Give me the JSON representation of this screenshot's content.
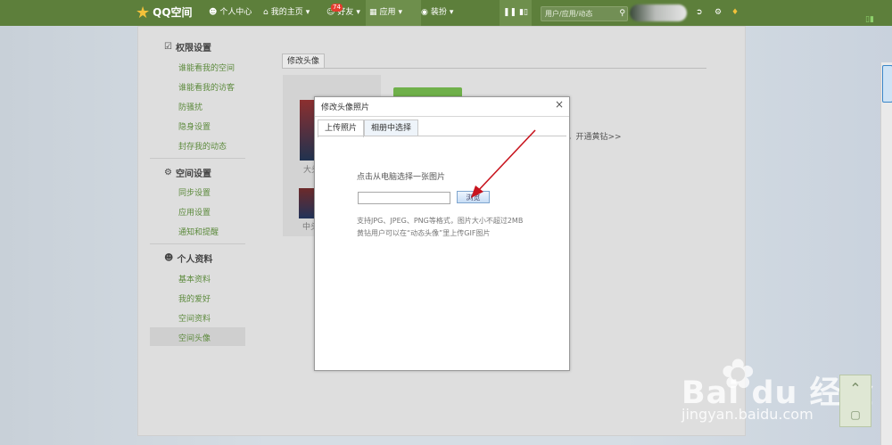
{
  "topbar": {
    "logo_text": "QQ空间",
    "nav": [
      {
        "label": "个人中心"
      },
      {
        "label": "我的主页",
        "has_dropdown": true
      },
      {
        "label": "好友",
        "badge": "74",
        "has_dropdown": true
      },
      {
        "label": "应用",
        "has_dropdown": true,
        "active": true
      },
      {
        "label": "装扮",
        "has_dropdown": true
      }
    ],
    "search_placeholder": "用户/应用/动态"
  },
  "sidebar": {
    "sections": [
      {
        "title": "权限设置",
        "icon": "lock-icon",
        "items": [
          "谁能看我的空间",
          "谁能看我的访客",
          "防骚扰",
          "隐身设置",
          "封存我的动态"
        ]
      },
      {
        "title": "空间设置",
        "icon": "settings-icon",
        "items": [
          "同步设置",
          "应用设置",
          "通知和提醒"
        ]
      },
      {
        "title": "个人资料",
        "icon": "profile-icon",
        "items": [
          "基本资料",
          "我的爱好",
          "空间资料",
          "空间头像"
        ]
      }
    ],
    "selected": "空间头像"
  },
  "background": {
    "tab_label": "修改头像",
    "label_large_partial": "大头",
    "label_medium_partial": "中头",
    "link_partial": "），开通黄钻>>"
  },
  "modal": {
    "title": "修改头像照片",
    "close": "×",
    "tabs": [
      "上传照片",
      "相册中选择"
    ],
    "prompt": "点击从电脑选择一张图片",
    "browse_label": "浏览",
    "hint1": "支持JPG、JPEG、PNG等格式，图片大小不超过2MB",
    "hint2": "黄钻用户可以在“动态头像”里上传GIF图片"
  },
  "watermark": {
    "logo": "Bai du 经验",
    "url": "jingyan.baidu.com"
  },
  "colors": {
    "topbar": "#5d7f3b",
    "link_green": "#5c8a3c",
    "arrow_red": "#c8141e"
  }
}
